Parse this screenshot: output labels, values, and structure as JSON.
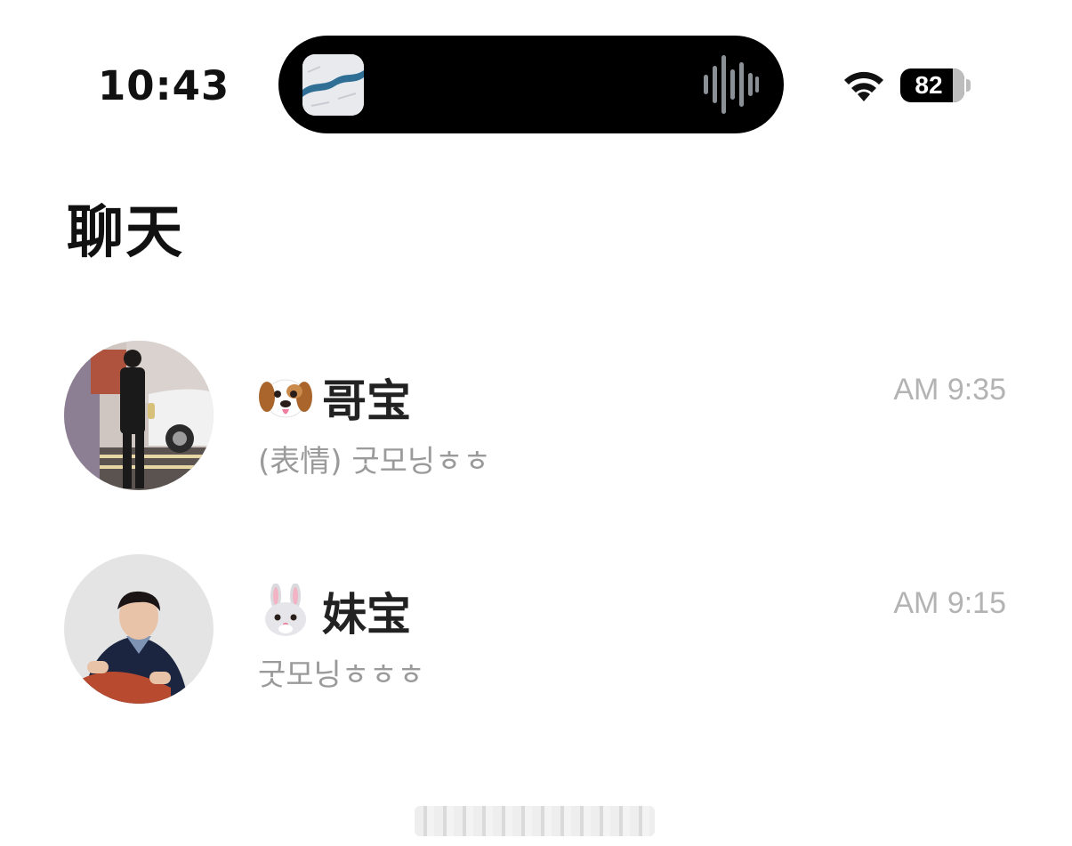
{
  "status_bar": {
    "time": "10:43",
    "battery_percent": "82",
    "battery_level": 0.82,
    "wifi_icon": "wifi-icon",
    "now_playing_icon": "waveform-icon"
  },
  "header": {
    "title": "聊天"
  },
  "chats": [
    {
      "emoji_icon": "dog-face-icon",
      "name": "哥宝",
      "time": "AM 9:35",
      "preview": "(表情) 굿모닝ㅎㅎ"
    },
    {
      "emoji_icon": "rabbit-face-icon",
      "name": "妹宝",
      "time": "AM 9:15",
      "preview": "굿모닝ㅎㅎㅎ"
    }
  ],
  "colors": {
    "background": "#ffffff",
    "title_text": "#111111",
    "name_text": "#222222",
    "meta_text": "#b3b3b3",
    "preview_text": "#9a9a9a",
    "island": "#000000"
  }
}
